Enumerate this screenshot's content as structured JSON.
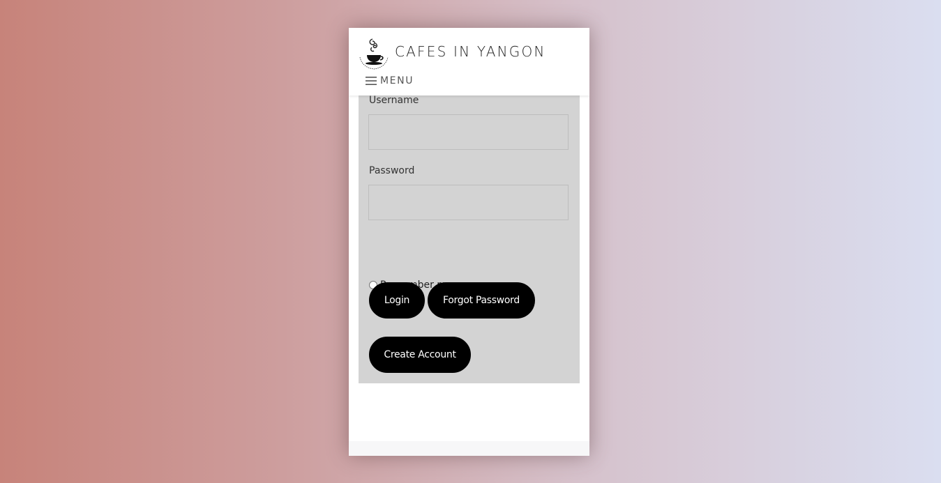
{
  "site": {
    "title": "CAFES IN YANGON",
    "logo_icon": "coffee-cup-logo-icon"
  },
  "nav": {
    "menu_label": "MENU",
    "menu_icon": "hamburger-icon"
  },
  "login_form": {
    "username_label": "Username",
    "username_value": "",
    "password_label": "Password",
    "password_value": "",
    "remember_label": "Remember me",
    "remember_checked": false,
    "login_button": "Login",
    "forgot_button": "Forgot Password",
    "create_button": "Create Account"
  },
  "colors": {
    "panel_bg": "#d3d3d3",
    "button_bg": "#000000",
    "button_text": "#ffffff"
  }
}
